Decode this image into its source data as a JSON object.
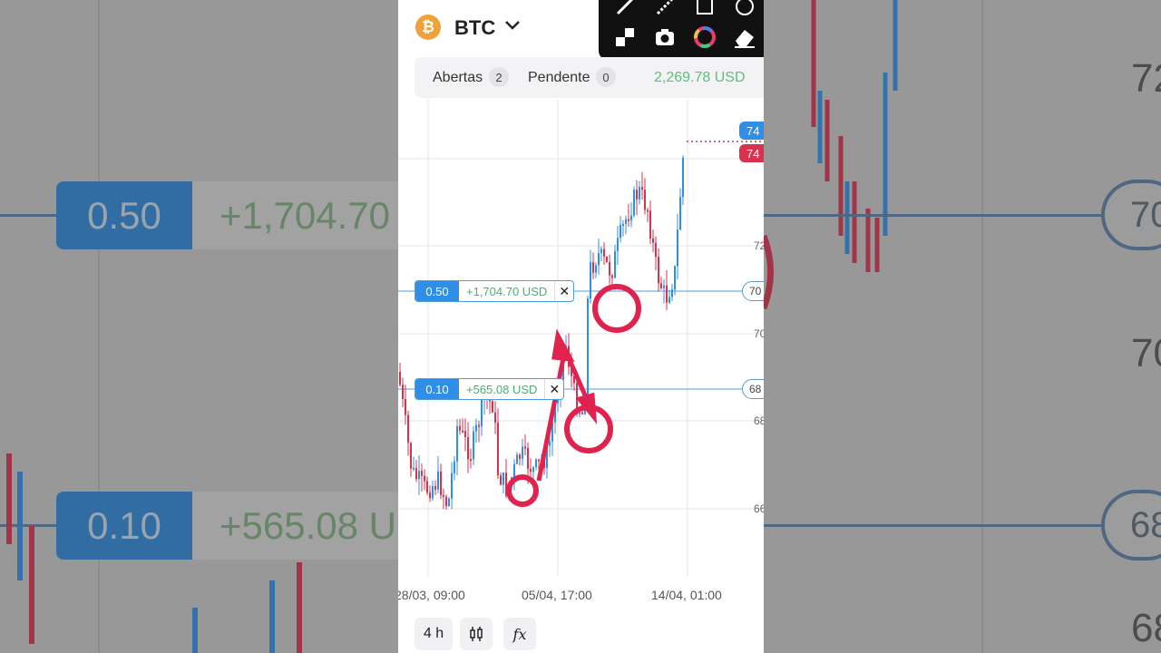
{
  "asset": {
    "symbol": "BTC",
    "icon": "bitcoin-icon",
    "brand_color": "#f0a23a"
  },
  "drawing_tools": [
    "brush-icon",
    "magic-brush-icon",
    "rectangle-icon",
    "circle-icon",
    "checker-icon",
    "camera-icon",
    "color-wheel-icon",
    "eraser-icon"
  ],
  "tabs": [
    {
      "label": "Abertas",
      "count": "2"
    },
    {
      "label": "Pendente",
      "count": "0"
    }
  ],
  "balance": "2,269.78 USD",
  "orders": [
    {
      "qty": "0.50",
      "pnl": "+1,704.70 USD",
      "axis": "70"
    },
    {
      "qty": "0.10",
      "pnl": "+565.08 USD",
      "axis": "68"
    }
  ],
  "price_tags": {
    "ask": "74",
    "bid": "74"
  },
  "y_axis_labels": [
    "72",
    "70",
    "68",
    "66"
  ],
  "x_axis_labels": [
    "28/03, 09:00",
    "05/04, 17:00",
    "14/04, 01:00"
  ],
  "bottom_bar": {
    "timeframe": "4 h",
    "candles_icon": "candlestick-icon",
    "indicators_icon": "fx-icon"
  },
  "background": {
    "left_pills": [
      {
        "qty": "0.50",
        "pnl": "+1,704.70"
      },
      {
        "qty": "0.10",
        "pnl": "+565.08 U"
      }
    ],
    "right_labels": [
      "72",
      "70",
      "70",
      "68",
      "68"
    ]
  },
  "colors": {
    "bull": "#2f8fe6",
    "bear": "#d8324f",
    "annotation": "#e0234e",
    "profit": "#3fb56a"
  }
}
